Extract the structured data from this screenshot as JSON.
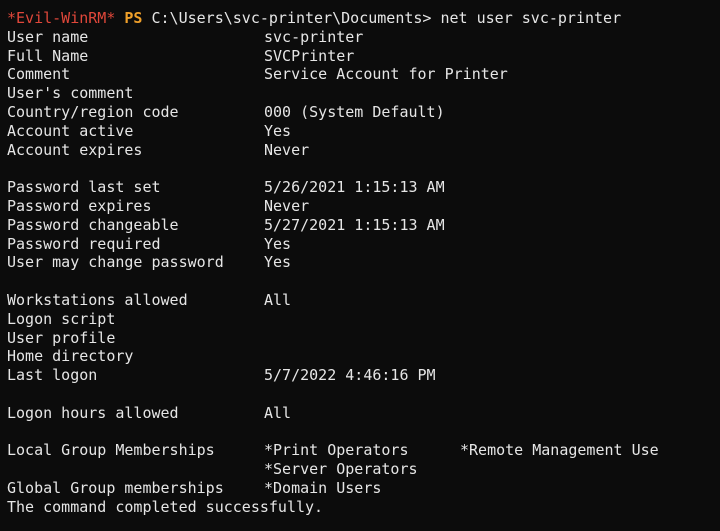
{
  "prompt": {
    "tag": "*Evil-WinRM*",
    "shell": "PS",
    "path": "C:\\Users\\svc-printer\\Documents>",
    "command": "net user svc-printer"
  },
  "fields_a": [
    {
      "label": "User name",
      "value": "svc-printer"
    },
    {
      "label": "Full Name",
      "value": "SVCPrinter"
    },
    {
      "label": "Comment",
      "value": "Service Account for Printer"
    },
    {
      "label": "User's comment",
      "value": ""
    },
    {
      "label": "Country/region code",
      "value": "000 (System Default)"
    },
    {
      "label": "Account active",
      "value": "Yes"
    },
    {
      "label": "Account expires",
      "value": "Never"
    }
  ],
  "fields_b": [
    {
      "label": "Password last set",
      "value": "5/26/2021 1:15:13 AM"
    },
    {
      "label": "Password expires",
      "value": "Never"
    },
    {
      "label": "Password changeable",
      "value": "5/27/2021 1:15:13 AM"
    },
    {
      "label": "Password required",
      "value": "Yes"
    },
    {
      "label": "User may change password",
      "value": "Yes"
    }
  ],
  "fields_c": [
    {
      "label": "Workstations allowed",
      "value": "All"
    },
    {
      "label": "Logon script",
      "value": ""
    },
    {
      "label": "User profile",
      "value": ""
    },
    {
      "label": "Home directory",
      "value": ""
    },
    {
      "label": "Last logon",
      "value": "5/7/2022 4:46:16 PM"
    }
  ],
  "fields_d": [
    {
      "label": "Logon hours allowed",
      "value": "All"
    }
  ],
  "groups": {
    "local_label": "Local Group Memberships",
    "local_1": "*Print Operators",
    "local_2": "*Remote Management Use",
    "local_3": "*Server Operators",
    "global_label": "Global Group memberships",
    "global_1": "*Domain Users"
  },
  "completion": "The command completed successfully."
}
